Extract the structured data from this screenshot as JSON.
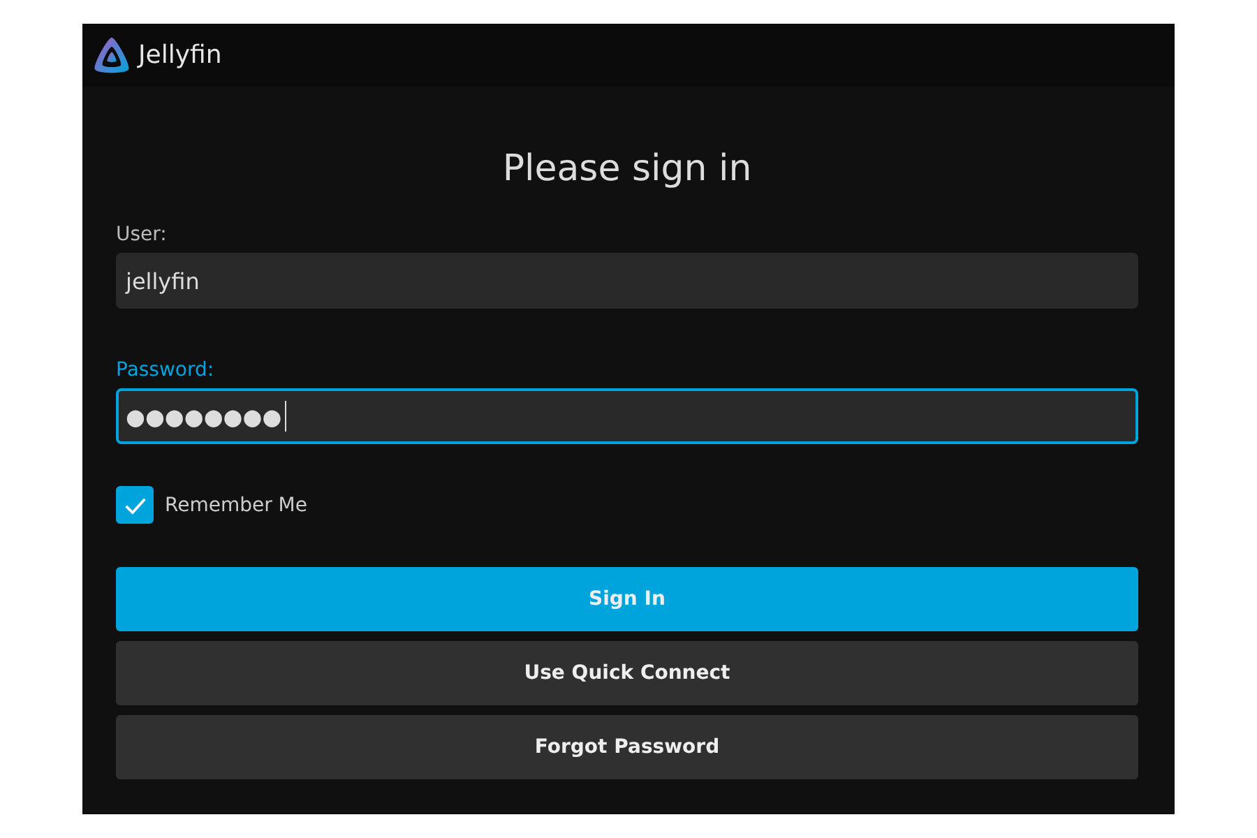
{
  "header": {
    "app_name": "Jellyfin"
  },
  "title": "Please sign in",
  "fields": [
    {
      "label": "User:",
      "value": "jellyfin",
      "focused": false
    },
    {
      "label": "Password:",
      "value": "●●●●●●●●",
      "focused": true
    }
  ],
  "remember_me": {
    "label": "Remember Me",
    "checked": true
  },
  "buttons": [
    {
      "label": "Sign In",
      "kind": "primary"
    },
    {
      "label": "Use Quick Connect",
      "kind": "secondary"
    },
    {
      "label": "Forgot Password",
      "kind": "secondary"
    }
  ]
}
